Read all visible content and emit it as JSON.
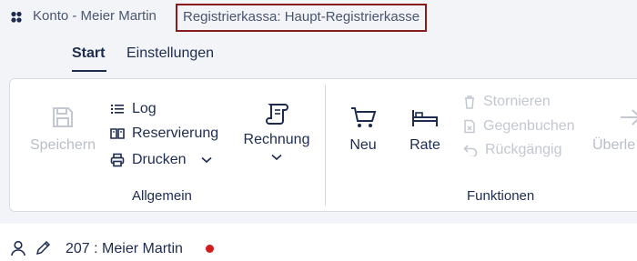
{
  "titlebar": {
    "app_title": "Konto - Meier Martin",
    "context_title": "Registrierkassa: Haupt-Registrierkasse"
  },
  "tabs": [
    {
      "label": "Start",
      "active": true
    },
    {
      "label": "Einstellungen",
      "active": false
    }
  ],
  "ribbon": {
    "groups": {
      "allgemein": {
        "label": "Allgemein",
        "speichern": "Speichern",
        "log": "Log",
        "reservierung": "Reservierung",
        "drucken": "Drucken",
        "rechnung": "Rechnung"
      },
      "funktionen": {
        "label": "Funktionen",
        "neu": "Neu",
        "rate": "Rate",
        "stornieren": "Stornieren",
        "gegenbuchen": "Gegenbuchen",
        "rueckgaengig": "Rückgängig",
        "ueberleiten": "Überle"
      }
    }
  },
  "status": {
    "text": "207 : Meier Martin",
    "dot_color": "#d21b1b"
  },
  "colors": {
    "accent": "#1d2b4f",
    "context_border": "#8b1a1a",
    "disabled": "#b8bdc8"
  },
  "icons": [
    "app-icon",
    "save-icon",
    "list-icon",
    "book-icon",
    "printer-icon",
    "chevron-down-icon",
    "scroll-icon",
    "cart-icon",
    "bed-icon",
    "trash-icon",
    "document-icon",
    "undo-icon",
    "arrow-right-icon",
    "user-icon",
    "pencil-icon"
  ]
}
